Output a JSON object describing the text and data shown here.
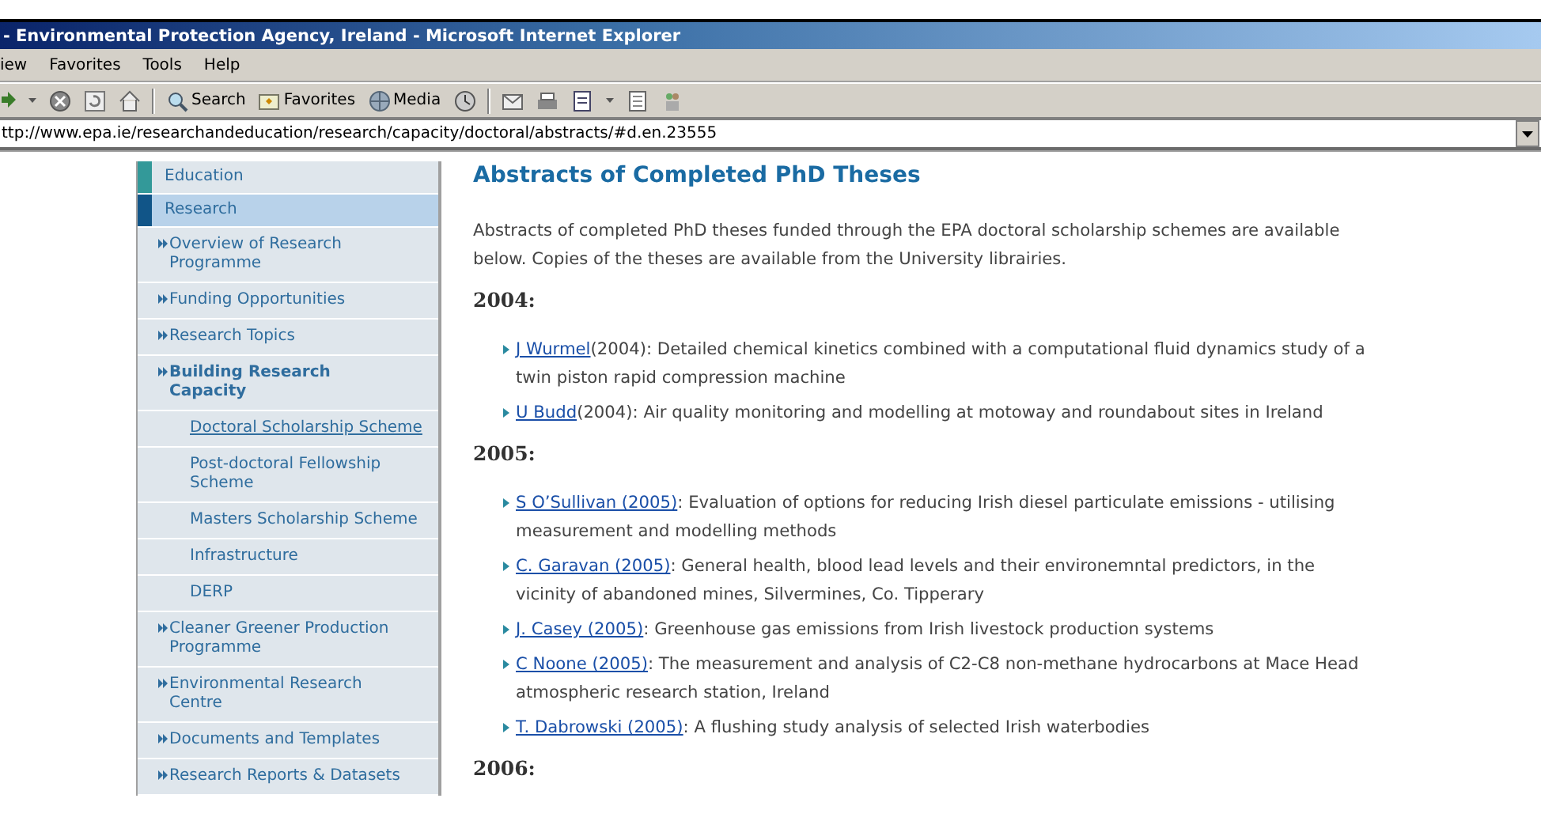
{
  "window": {
    "title": "- Environmental Protection Agency, Ireland - Microsoft Internet Explorer"
  },
  "menu": [
    "iew",
    "Favorites",
    "Tools",
    "Help"
  ],
  "toolbar": [
    {
      "kind": "forward"
    },
    {
      "kind": "dropdown"
    },
    {
      "kind": "stop"
    },
    {
      "kind": "refresh"
    },
    {
      "kind": "home"
    },
    {
      "kind": "separator"
    },
    {
      "kind": "search",
      "label": "Search"
    },
    {
      "kind": "favorites",
      "label": "Favorites"
    },
    {
      "kind": "media",
      "label": "Media"
    },
    {
      "kind": "history"
    },
    {
      "kind": "separator"
    },
    {
      "kind": "mail"
    },
    {
      "kind": "print"
    },
    {
      "kind": "edit"
    },
    {
      "kind": "dropdown"
    },
    {
      "kind": "discuss"
    },
    {
      "kind": "messenger"
    }
  ],
  "address": {
    "value": "ttp://www.epa.ie/researchandeducation/research/capacity/doctoral/abstracts/#d.en.23555"
  },
  "sidebar": {
    "items": [
      {
        "label": "Education",
        "selected": false,
        "color": "#339999"
      },
      {
        "label": "Research",
        "selected": true,
        "color": "#115588",
        "children": [
          {
            "label": "Overview of Research Programme",
            "selected": false
          },
          {
            "label": "Funding Opportunities",
            "selected": false
          },
          {
            "label": "Research Topics",
            "selected": false
          },
          {
            "label": "Building Research Capacity",
            "selected": true,
            "children": [
              {
                "label": "Doctoral Scholarship Scheme",
                "selected": true
              },
              {
                "label": "Post-doctoral Fellowship Scheme",
                "selected": false
              },
              {
                "label": "Masters Scholarship Scheme",
                "selected": false
              },
              {
                "label": "Infrastructure",
                "selected": false
              },
              {
                "label": "DERP",
                "selected": false
              }
            ]
          },
          {
            "label": "Cleaner Greener Production Programme",
            "selected": false
          },
          {
            "label": "Environmental Research Centre",
            "selected": false
          },
          {
            "label": "Documents and Templates",
            "selected": false
          },
          {
            "label": "Research Reports & Datasets",
            "selected": false
          }
        ]
      }
    ]
  },
  "content": {
    "heading": "Abstracts of Completed PhD Theses",
    "intro": "Abstracts of completed PhD theses funded through the EPA doctoral scholarship schemes are available below. Copies of the theses are available from the University librairies.",
    "sections": [
      {
        "year": "2004:",
        "entries": [
          {
            "author": "J Wurmel",
            "text": "(2004): Detailed chemical kinetics combined with a computational fluid dynamics study of a twin piston rapid compression machine"
          },
          {
            "author": "U Budd",
            "text": "(2004): Air quality monitoring and modelling at motoway and roundabout sites in Ireland"
          }
        ]
      },
      {
        "year": "2005:",
        "entries": [
          {
            "author": "S O’Sullivan (2005)",
            "text": ": Evaluation of options for reducing Irish diesel particulate emissions - utilising measurement and modelling methods"
          },
          {
            "author": "C. Garavan (2005)",
            "text": ": General health, blood lead levels and their environemntal predictors, in the vicinity of abandoned mines, Silvermines, Co. Tipperary"
          },
          {
            "author": "J. Casey (2005)",
            "text": ": Greenhouse gas emissions from Irish livestock production systems"
          },
          {
            "author": "C Noone (2005)",
            "text": ": The measurement and analysis of C2-C8 non-methane hydrocarbons at Mace Head atmospheric research station, Ireland"
          },
          {
            "author": "T. Dabrowski (2005)",
            "text": ": A flushing study analysis of selected Irish waterbodies"
          }
        ]
      },
      {
        "year": "2006:"
      }
    ]
  }
}
